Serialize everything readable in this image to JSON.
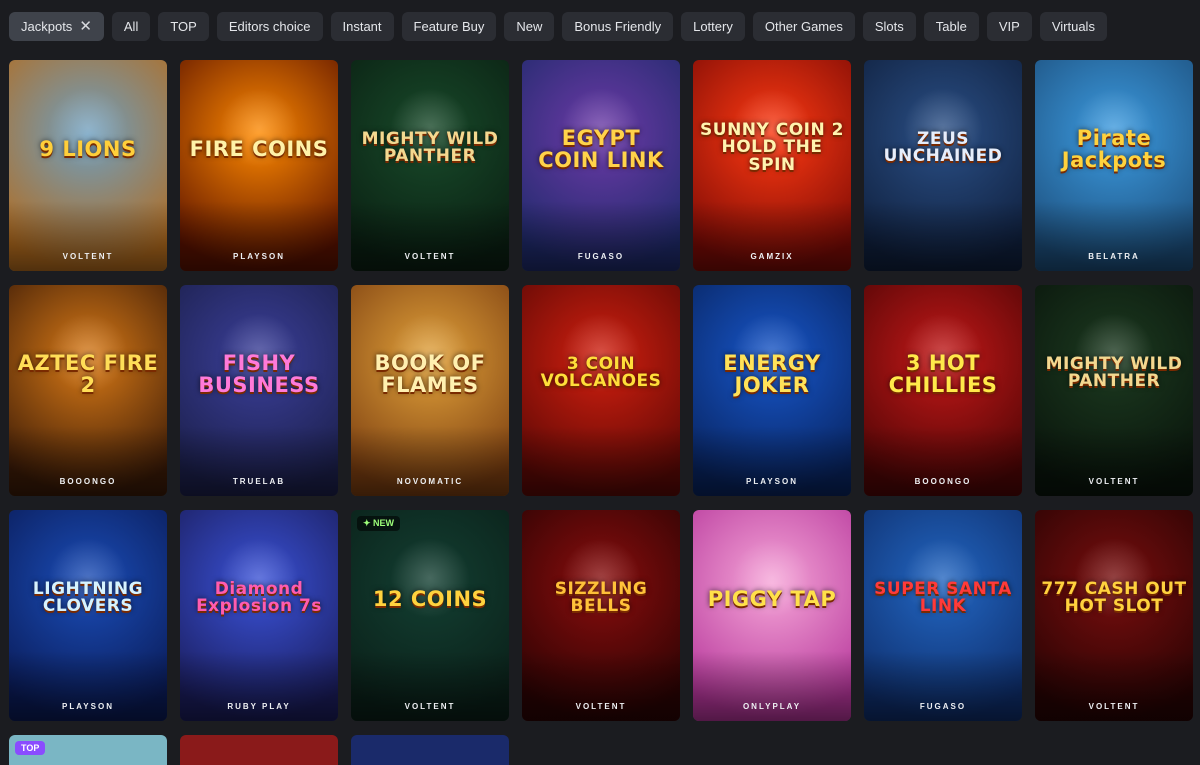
{
  "filters": [
    {
      "label": "Jackpots",
      "active": true
    },
    {
      "label": "All"
    },
    {
      "label": "TOP"
    },
    {
      "label": "Editors choice"
    },
    {
      "label": "Instant"
    },
    {
      "label": "Feature Buy"
    },
    {
      "label": "New"
    },
    {
      "label": "Bonus Friendly"
    },
    {
      "label": "Lottery"
    },
    {
      "label": "Other Games"
    },
    {
      "label": "Slots"
    },
    {
      "label": "Table"
    },
    {
      "label": "VIP"
    },
    {
      "label": "Virtuals"
    }
  ],
  "clear_filter_symbol": "✕",
  "games": [
    {
      "title": "9 LIONS",
      "provider": "VOLTENT",
      "bg": [
        "#6e9fc0",
        "#b36b1d"
      ],
      "color": "#ffcf3a"
    },
    {
      "title": "FIRE COINS",
      "provider": "PLAYSON",
      "bg": [
        "#ff8a00",
        "#5a1100"
      ],
      "color": "#fff2a8"
    },
    {
      "title": "MIGHTY WILD PANTHER",
      "provider": "VOLTENT",
      "bg": [
        "#184a2a",
        "#0a1f12"
      ],
      "color": "#f3d890",
      "small": true
    },
    {
      "title": "EGYPT COIN LINK",
      "provider": "FUGASO",
      "bg": [
        "#6d3aa8",
        "#1e2a6a"
      ],
      "color": "#ffd34a"
    },
    {
      "title": "SUNNY COIN 2 HOLD THE SPIN",
      "provider": "GAMZIX",
      "bg": [
        "#ff3a12",
        "#7a0a05"
      ],
      "color": "#fff3b0",
      "small": true
    },
    {
      "title": "ZEUS UNCHAINED",
      "provider": "",
      "bg": [
        "#2a4f86",
        "#0f1f3c"
      ],
      "color": "#e6eefc",
      "small": true
    },
    {
      "title": "Pirate Jackpots",
      "provider": "BELATRA",
      "bg": [
        "#3c9be0",
        "#1c4d7a"
      ],
      "color": "#ffd23e"
    },
    {
      "title": "AZTEC FIRE 2",
      "provider": "BOOONGO",
      "bg": [
        "#d97a16",
        "#3a1a07"
      ],
      "color": "#ffde57"
    },
    {
      "title": "FISHY BUSINESS",
      "provider": "TRUELAB",
      "bg": [
        "#3b3f9a",
        "#1b1f4a"
      ],
      "color": "#ff7ad9"
    },
    {
      "title": "BOOK OF FLAMES",
      "provider": "NOVOMATIC",
      "bg": [
        "#e2a23a",
        "#7a3d10"
      ],
      "color": "#fff0b0"
    },
    {
      "title": "3 COIN VOLCANOES",
      "provider": "",
      "bg": [
        "#d11f0f",
        "#5a0805"
      ],
      "color": "#ffde3a",
      "small": true
    },
    {
      "title": "ENERGY JOKER",
      "provider": "PLAYSON",
      "bg": [
        "#1756c9",
        "#08235e"
      ],
      "color": "#ffe259"
    },
    {
      "title": "3 HOT CHILLIES",
      "provider": "BOOONGO",
      "bg": [
        "#c31818",
        "#4d0505"
      ],
      "color": "#ffe94a"
    },
    {
      "title": "MIGHTY WILD PANTHER",
      "provider": "VOLTENT",
      "bg": [
        "#1c3a20",
        "#09140b"
      ],
      "color": "#f3d890",
      "small": true
    },
    {
      "title": "LIGHTNING CLOVERS",
      "provider": "PLAYSON",
      "bg": [
        "#1a4db8",
        "#0a1a55"
      ],
      "color": "#d6f3ff",
      "small": true
    },
    {
      "title": "Diamond Explosion 7s",
      "provider": "RUBY PLAY",
      "bg": [
        "#3a52d8",
        "#1a1c5a"
      ],
      "color": "#ff5cb0",
      "small": true
    },
    {
      "title": "12 COINS",
      "provider": "VOLTENT",
      "bg": [
        "#133f32",
        "#0a1f18"
      ],
      "color": "#ffd23e",
      "badge": "✦ NEW",
      "badge_type": "new"
    },
    {
      "title": "SIZZLING BELLS",
      "provider": "VOLTENT",
      "bg": [
        "#8a0d0d",
        "#2a0303"
      ],
      "color": "#ffc23a",
      "small": true
    },
    {
      "title": "PIGGY TAP",
      "provider": "ONLYPLAY",
      "bg": [
        "#f6a6d8",
        "#b5359a"
      ],
      "color": "#ffe14a"
    },
    {
      "title": "SUPER SANTA LINK",
      "provider": "FUGASO",
      "bg": [
        "#2266c2",
        "#0e2d6a"
      ],
      "color": "#ff3a3a",
      "small": true
    },
    {
      "title": "777 CASH OUT HOT SLOT",
      "provider": "VOLTENT",
      "bg": [
        "#7a0e0e",
        "#260303"
      ],
      "color": "#ffd23e",
      "small": true
    }
  ],
  "partial_row": [
    {
      "bg": "#7ab6c4",
      "badge": "TOP"
    },
    {
      "bg": "#8a1a1a"
    },
    {
      "bg": "#1a2a6a"
    }
  ]
}
